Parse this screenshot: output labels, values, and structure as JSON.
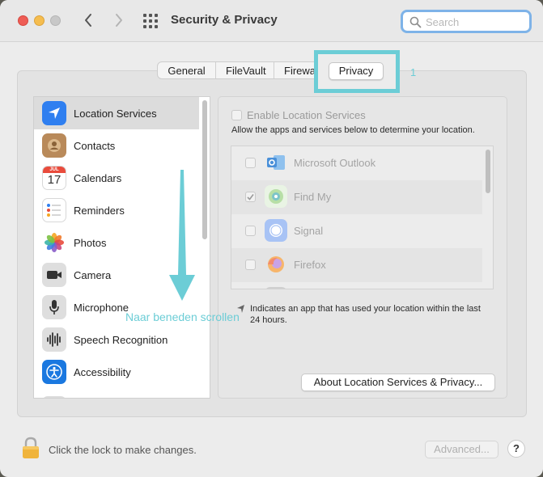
{
  "window": {
    "title": "Security & Privacy",
    "search_placeholder": "Search"
  },
  "tabs": [
    {
      "label": "General"
    },
    {
      "label": "FileVault"
    },
    {
      "label": "Firewall"
    },
    {
      "label": "Privacy",
      "selected": true
    }
  ],
  "annotations": {
    "step_number": "1",
    "scroll_hint": "Naar beneden scrollen",
    "accent_color": "#6ccdd6"
  },
  "sidebar": {
    "items": [
      {
        "label": "Location Services",
        "icon": "location-arrow-icon",
        "selected": true
      },
      {
        "label": "Contacts",
        "icon": "contacts-icon"
      },
      {
        "label": "Calendars",
        "icon": "calendar-icon",
        "icon_month": "JUL",
        "icon_day": "17"
      },
      {
        "label": "Reminders",
        "icon": "reminders-icon"
      },
      {
        "label": "Photos",
        "icon": "photos-icon"
      },
      {
        "label": "Camera",
        "icon": "camera-icon"
      },
      {
        "label": "Microphone",
        "icon": "microphone-icon"
      },
      {
        "label": "Speech Recognition",
        "icon": "waveform-icon"
      },
      {
        "label": "Accessibility",
        "icon": "accessibility-icon"
      }
    ]
  },
  "location": {
    "enable_label": "Enable Location Services",
    "enable_checked": false,
    "description": "Allow the apps and services below to determine your location.",
    "apps": [
      {
        "name": "Microsoft Outlook",
        "checked": false,
        "icon": "outlook-icon"
      },
      {
        "name": "Find My",
        "checked": true,
        "icon": "find-my-icon"
      },
      {
        "name": "Signal",
        "checked": false,
        "icon": "signal-icon"
      },
      {
        "name": "Firefox",
        "checked": false,
        "icon": "firefox-icon"
      }
    ],
    "legend_text": "Indicates an app that has used your location within the last 24 hours.",
    "about_button": "About Location Services & Privacy..."
  },
  "footer": {
    "lock_text": "Click the lock to make changes.",
    "advanced_button": "Advanced...",
    "help_button": "?"
  }
}
